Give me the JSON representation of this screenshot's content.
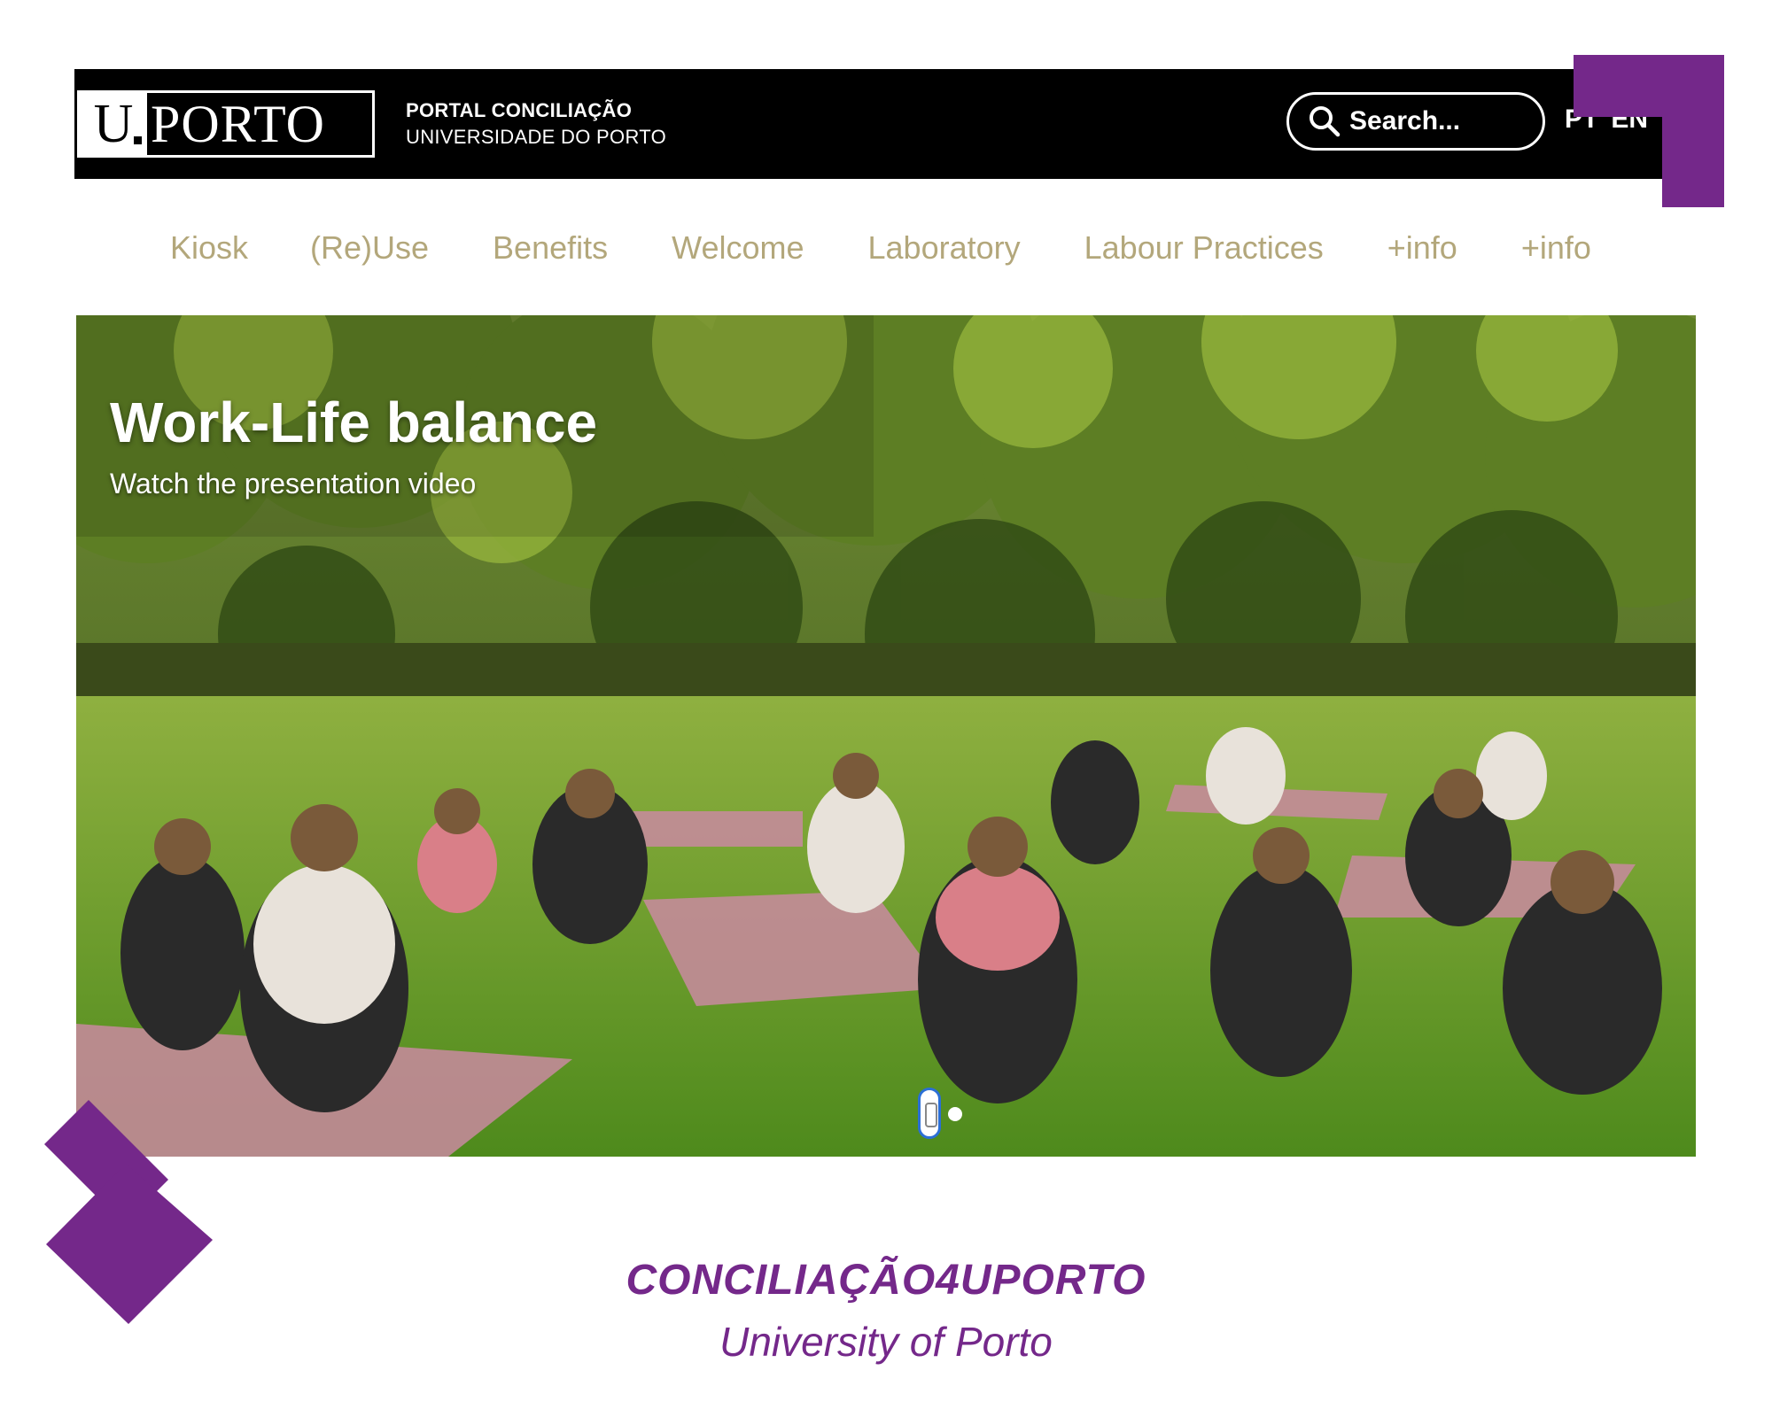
{
  "header": {
    "logo_u": "U",
    "logo_porto": "PORTO",
    "portal_line1": "PORTAL CONCILIAÇÃO",
    "portal_line2": "UNIVERSIDADE DO PORTO",
    "search_placeholder": "Search...",
    "lang_pt": "PT",
    "lang_en": "EN"
  },
  "nav": {
    "items": [
      "Kiosk",
      "(Re)Use",
      "Benefits",
      "Welcome",
      "Laboratory",
      "Labour Practices",
      "+info",
      "+info"
    ]
  },
  "hero": {
    "title": "Work-Life balance",
    "subtitle": "Watch the presentation video",
    "slide_count": 2,
    "active_slide": 1
  },
  "caption": {
    "title": "CONCILIAÇÃO4UPORTO",
    "subtitle": "University of Porto"
  },
  "colors": {
    "accent_purple": "#74288a",
    "nav_text": "#b3a77b",
    "header_bg": "#000000"
  }
}
